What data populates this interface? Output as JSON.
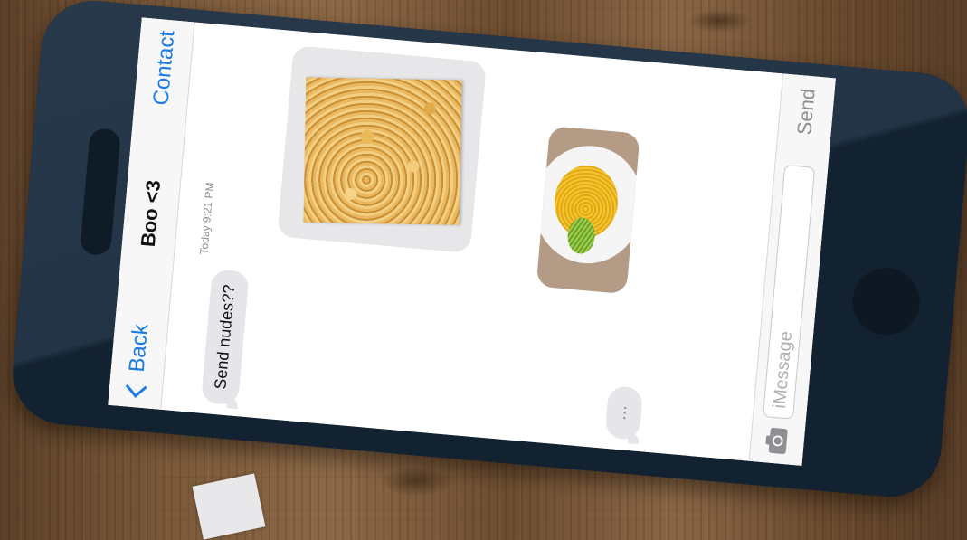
{
  "nav": {
    "back_label": "Back",
    "title": "Boo <3",
    "contact_label": "Contact"
  },
  "conversation": {
    "timestamp": "Today 9:21 PM",
    "messages": [
      {
        "from": "contact",
        "type": "text",
        "text": "Send nudes??"
      },
      {
        "from": "me",
        "type": "image",
        "icon": "instant-noodle-block-photo"
      },
      {
        "from": "me",
        "type": "image",
        "icon": "noodle-plate-photo"
      },
      {
        "from": "contact",
        "type": "typing",
        "text": "..."
      }
    ]
  },
  "composer": {
    "camera_icon": "camera-icon",
    "placeholder": "iMessage",
    "send_label": "Send"
  },
  "colors": {
    "accent": "#1a7de6",
    "phone_body": "#132230",
    "bubble_gray": "#e5e5ea"
  }
}
